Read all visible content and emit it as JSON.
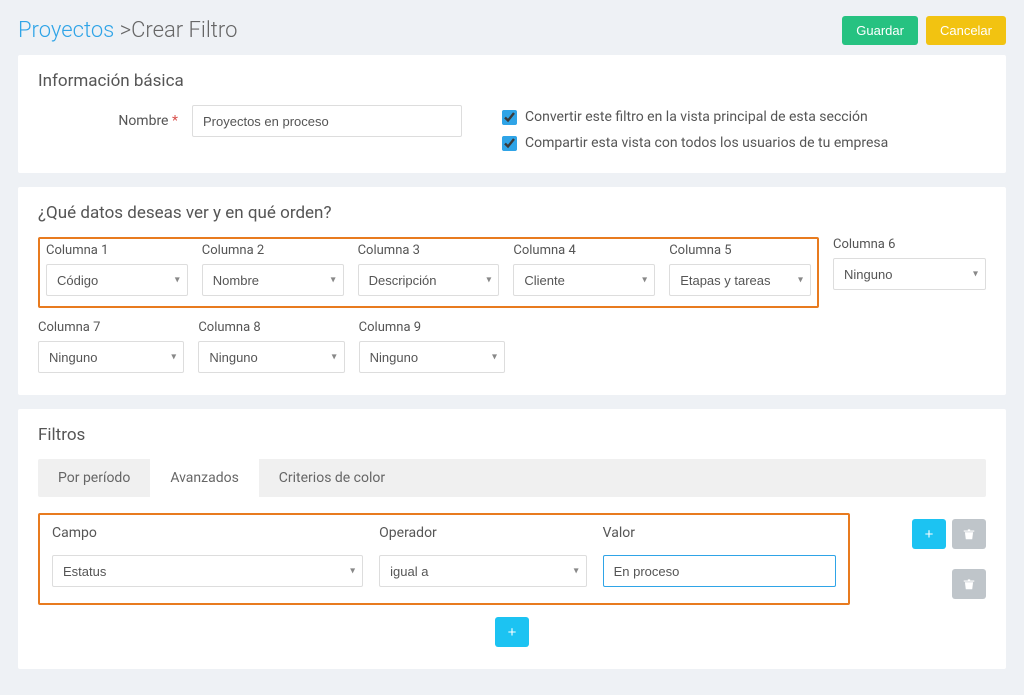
{
  "breadcrumb": {
    "link": "Proyectos",
    "sep": ">",
    "current": "Crear Filtro"
  },
  "actions": {
    "save": "Guardar",
    "cancel": "Cancelar"
  },
  "basic": {
    "title": "Información básica",
    "name_label": "Nombre",
    "name_value": "Proyectos en proceso",
    "check_main": "Convertir este filtro en la vista principal de esta sección",
    "check_share": "Compartir esta vista con todos los usuarios de tu empresa"
  },
  "columns": {
    "title": "¿Qué datos deseas ver y en qué orden?",
    "labels": [
      "Columna 1",
      "Columna 2",
      "Columna 3",
      "Columna 4",
      "Columna 5",
      "Columna 6",
      "Columna 7",
      "Columna 8",
      "Columna 9"
    ],
    "values": [
      "Código",
      "Nombre",
      "Descripción",
      "Cliente",
      "Etapas y tareas",
      "Ninguno",
      "Ninguno",
      "Ninguno",
      "Ninguno"
    ]
  },
  "filters": {
    "title": "Filtros",
    "tabs": {
      "periodo": "Por período",
      "avanzados": "Avanzados",
      "color": "Criterios de color"
    },
    "headers": {
      "campo": "Campo",
      "operador": "Operador",
      "valor": "Valor"
    },
    "row": {
      "campo": "Estatus",
      "operador": "igual a",
      "valor": "En proceso"
    }
  }
}
